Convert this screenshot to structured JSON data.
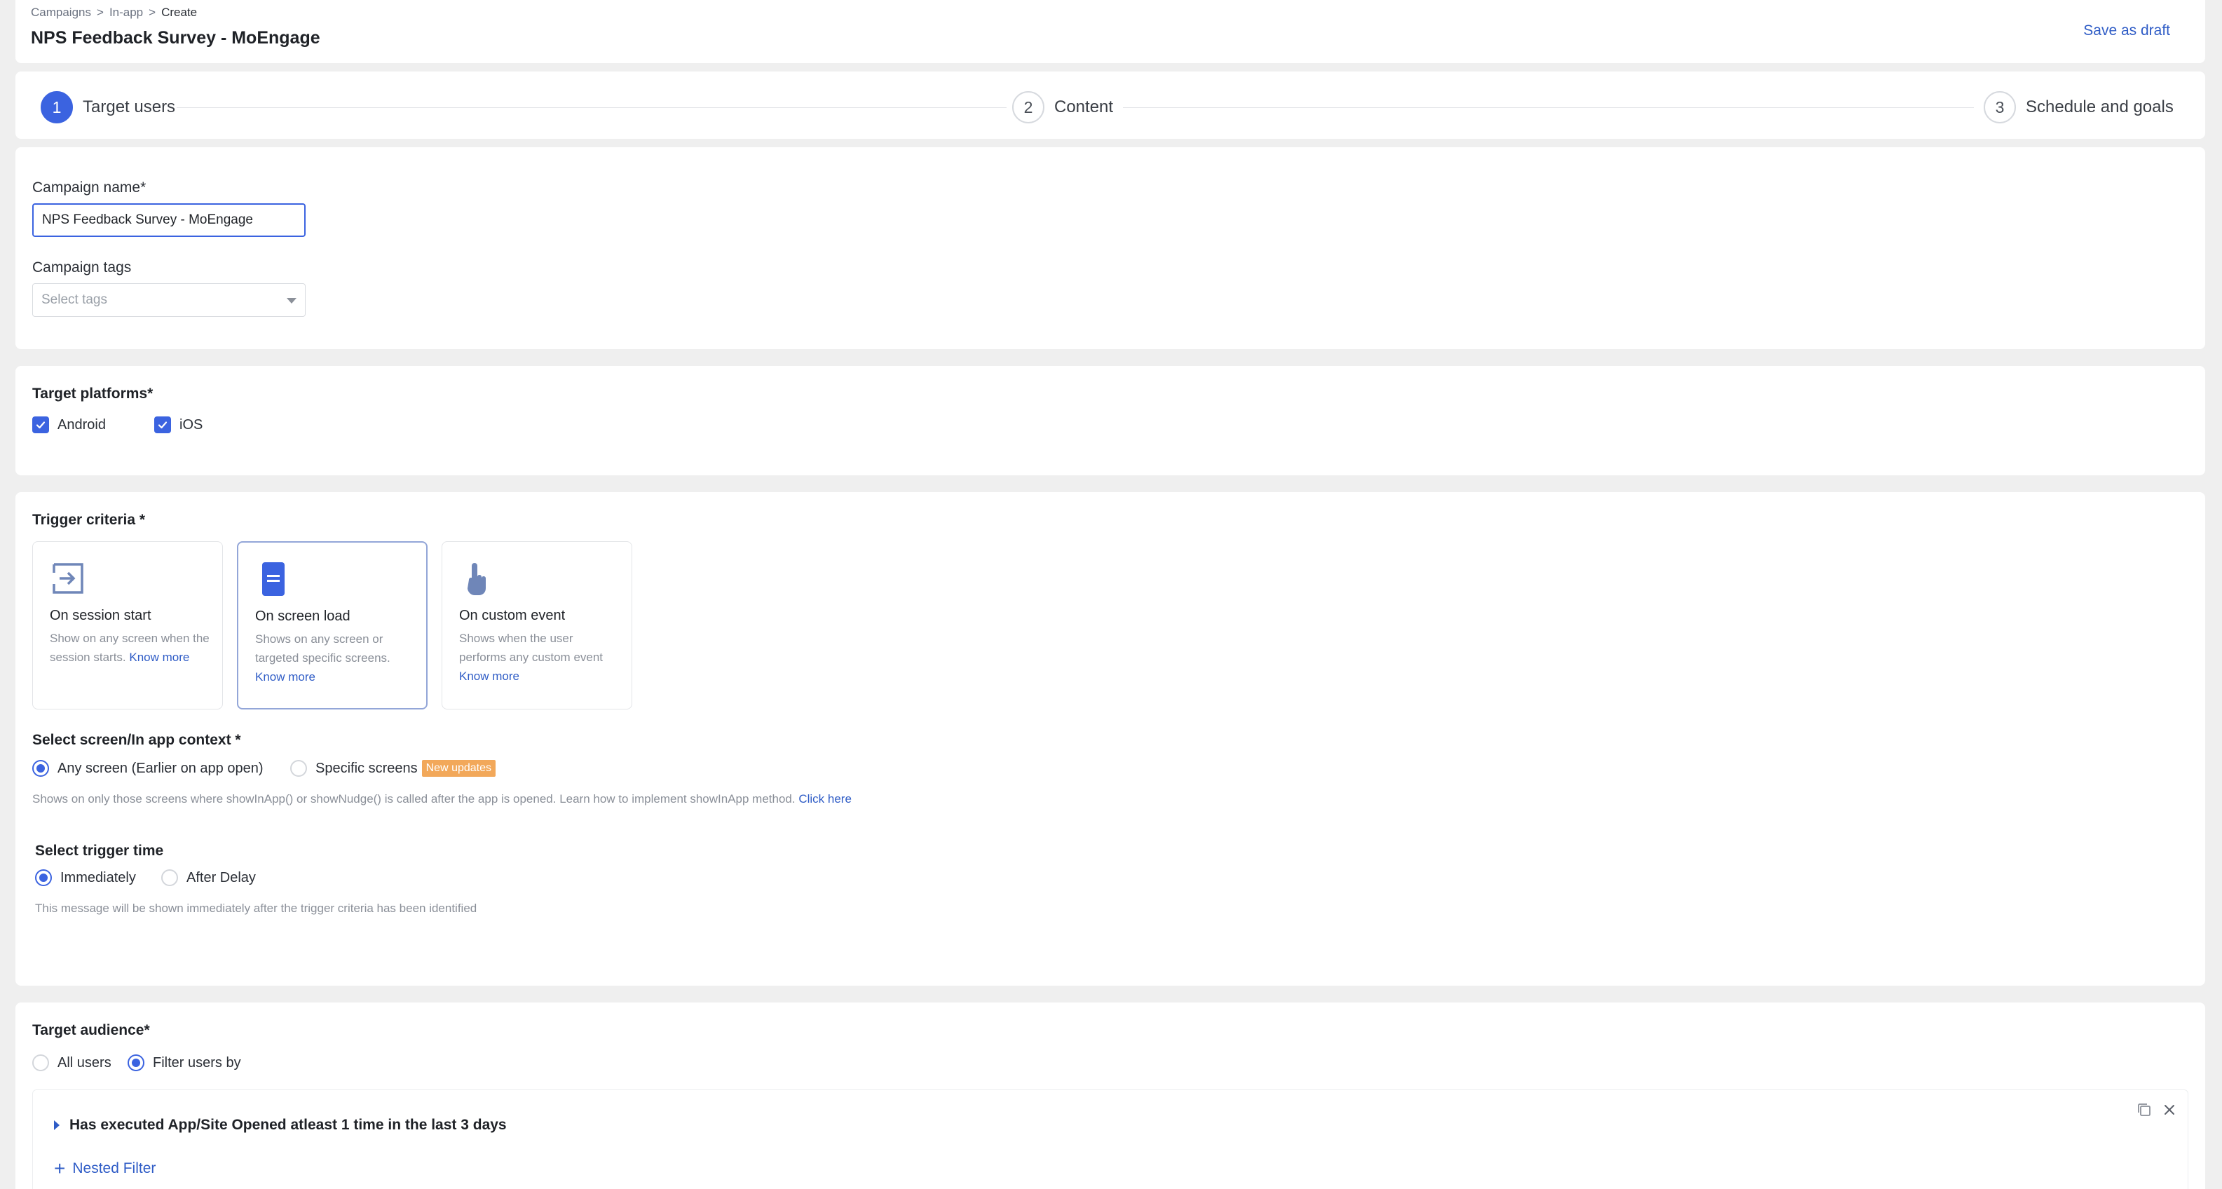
{
  "breadcrumb": [
    "Campaigns",
    "In-app",
    "Create"
  ],
  "breadcrumb_sep": ">",
  "page_title": "NPS Feedback Survey - MoEngage",
  "save_draft": "Save as draft",
  "steps": [
    {
      "num": "1",
      "label": "Target users"
    },
    {
      "num": "2",
      "label": "Content"
    },
    {
      "num": "3",
      "label": "Schedule and goals"
    }
  ],
  "campaign": {
    "name_label": "Campaign name*",
    "name_value": "NPS Feedback Survey - MoEngage",
    "tags_label": "Campaign tags",
    "tags_placeholder": "Select tags"
  },
  "platforms": {
    "title": "Target platforms*",
    "android": "Android",
    "ios": "iOS"
  },
  "trigger": {
    "title": "Trigger criteria *",
    "cards": [
      {
        "title": "On session start",
        "desc": "Show on any screen when the session starts.",
        "link": "Know more"
      },
      {
        "title": "On screen load",
        "desc": "Shows on any screen or targeted specific screens.",
        "link": "Know more"
      },
      {
        "title": "On custom event",
        "desc": "Shows when the user performs any custom event",
        "link": "Know more"
      }
    ],
    "context_title": "Select screen/In app context *",
    "any_screen": "Any screen (Earlier on app open)",
    "specific_screens": "Specific screens",
    "badge": "New updates",
    "context_help": "Shows on only those screens where showInApp() or showNudge() is called after the app is opened. Learn how to implement showInApp method.",
    "context_link": "Click here",
    "time_title": "Select trigger time",
    "immediately": "Immediately",
    "after_delay": "After Delay",
    "time_help": "This message will be shown immediately after the trigger criteria has been identified"
  },
  "audience": {
    "title": "Target audience*",
    "all_users": "All users",
    "filter_users": "Filter users by",
    "filter_text": "Has executed App/Site Opened atleast 1 time in the last 3 days",
    "nested": "Nested Filter"
  },
  "colors": {
    "accent": "#3b63e0",
    "link": "#2f5cc6",
    "badge": "#f2a85a"
  }
}
